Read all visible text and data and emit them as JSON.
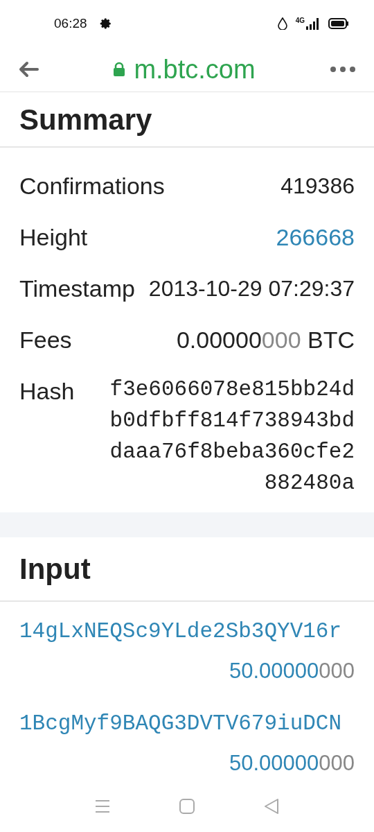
{
  "status_bar": {
    "time": "06:28",
    "network": "4G"
  },
  "browser": {
    "url": "m.btc.com"
  },
  "summary": {
    "title": "Summary",
    "rows": [
      {
        "kind": "plain",
        "label": "Confirmations",
        "value": "419386"
      },
      {
        "kind": "link",
        "label": "Height",
        "value": "266668"
      },
      {
        "kind": "plain",
        "label": "Timestamp",
        "value": "2013-10-29 07:29:37"
      },
      {
        "kind": "amount",
        "label": "Fees",
        "main": "0.00000",
        "tail": "000",
        "unit": "BTC"
      },
      {
        "kind": "hash",
        "label": "Hash",
        "value": "f3e6066078e815bb24db0dfbff814f738943bddaaa76f8beba360cfe2882480a"
      }
    ]
  },
  "input": {
    "title": "Input",
    "items": [
      {
        "address": "14gLxNEQSc9YLde2Sb3QYV16r",
        "main": "50.00000",
        "tail": "000"
      },
      {
        "address": "1BcgMyf9BAQG3DVTV679iuDCN",
        "main": "50.00000",
        "tail": "000"
      }
    ]
  }
}
